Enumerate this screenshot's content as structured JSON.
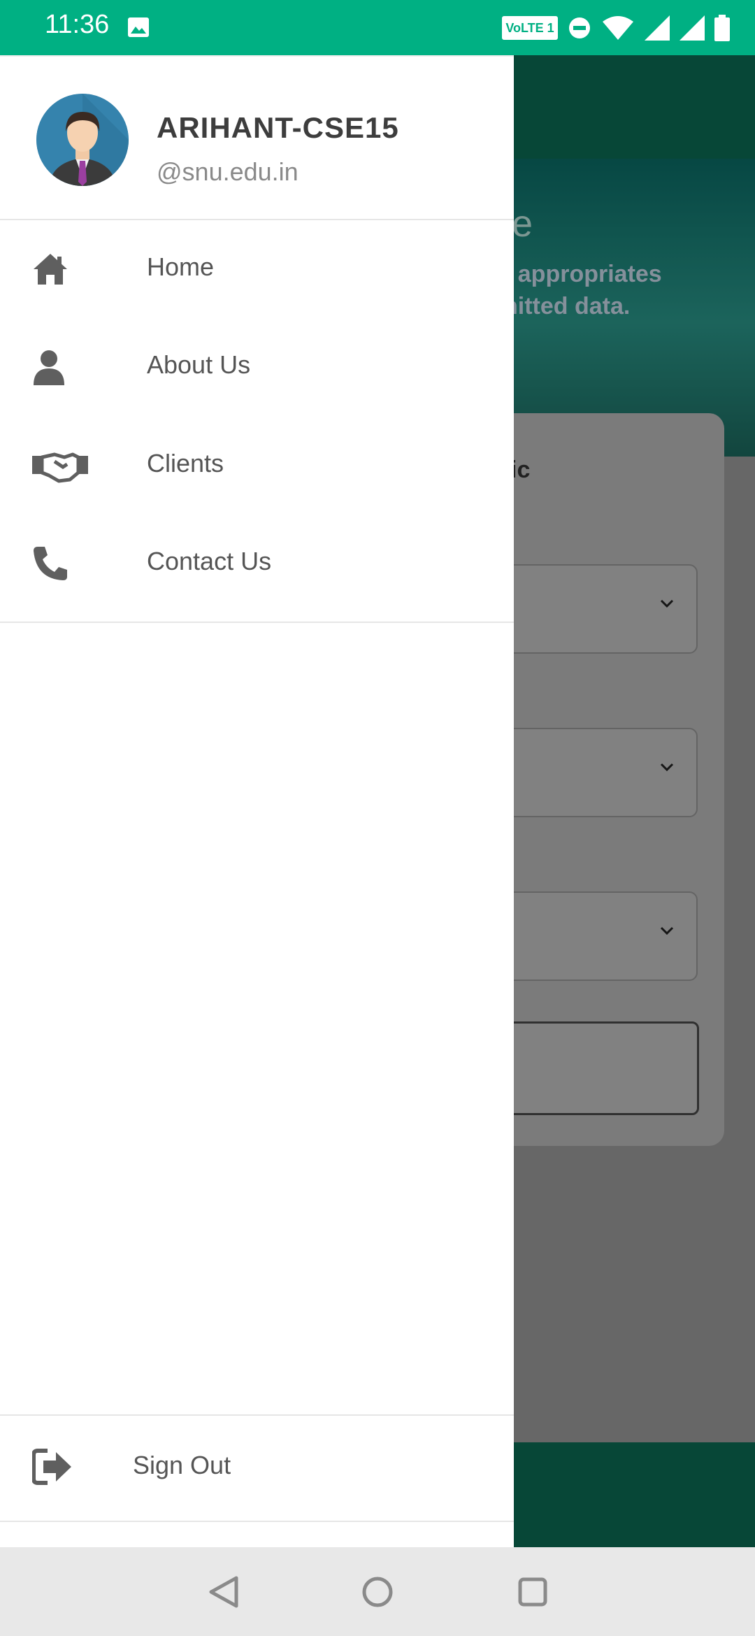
{
  "status_bar": {
    "time": "11:36",
    "volte_label": "VoLTE 1",
    "icons": [
      "image-icon",
      "volte-icon",
      "dnd-icon",
      "wifi-icon",
      "signal-icon",
      "signal-icon",
      "battery-icon"
    ]
  },
  "drawer": {
    "profile": {
      "username": "ARIHANT-CSE15",
      "email": "@snu.edu.in"
    },
    "items": [
      {
        "label": "Home",
        "icon": "home-icon"
      },
      {
        "label": "About Us",
        "icon": "person-icon"
      },
      {
        "label": "Clients",
        "icon": "handshake-icon"
      },
      {
        "label": "Contact Us",
        "icon": "phone-icon"
      }
    ],
    "sign_out": {
      "label": "Sign Out",
      "icon": "sign-out-icon"
    }
  },
  "background_app": {
    "hero_title_fragment": "ide",
    "hero_sub_line1": "t appropriates",
    "hero_sub_line2": "nitted data.",
    "card_label_fragment": "ic"
  },
  "colors": {
    "status_bar": "#00B083",
    "app_bar": "#0b6e55",
    "drawer_bg": "#ffffff",
    "icon_gray": "#5f5f5f"
  }
}
